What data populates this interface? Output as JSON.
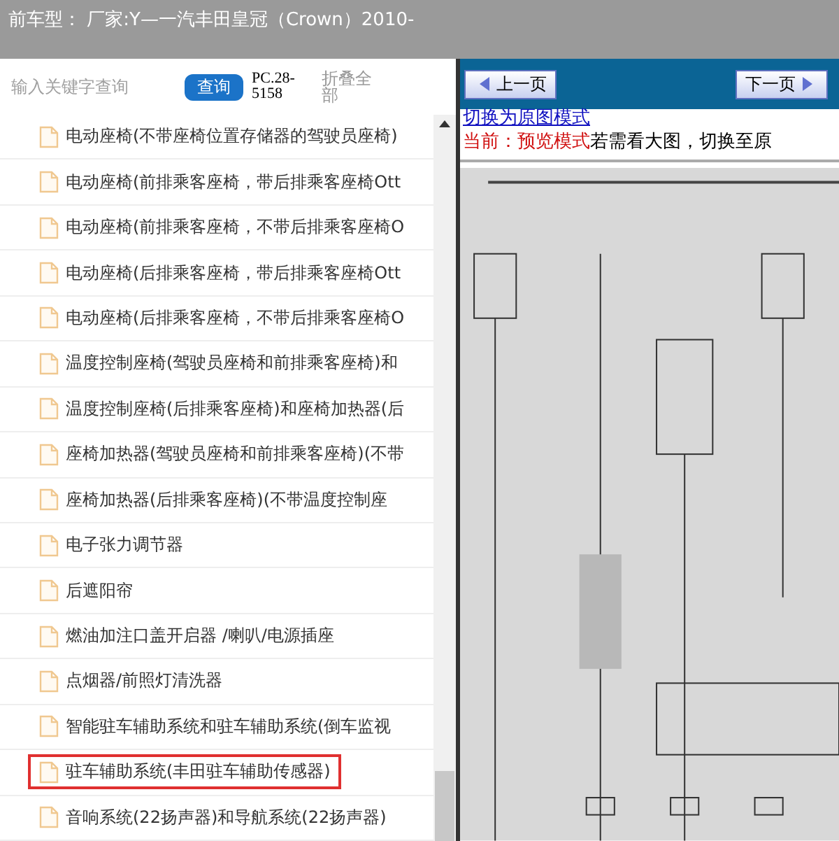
{
  "header": {
    "title": "前车型： 厂家:Y—一汽丰田皇冠（Crown）2010-"
  },
  "toolbar": {
    "search": {
      "placeholder": "输入关键字查询"
    },
    "search_button": "查询",
    "code": "PC.28-5158",
    "collapse_all": "折叠全部"
  },
  "tree": {
    "items": [
      {
        "label": "电动座椅(不带座椅位置存储器的驾驶员座椅)",
        "selected": false
      },
      {
        "label": "电动座椅(前排乘客座椅，带后排乘客座椅Ott",
        "selected": false
      },
      {
        "label": "电动座椅(前排乘客座椅，不带后排乘客座椅O",
        "selected": false
      },
      {
        "label": "电动座椅(后排乘客座椅，带后排乘客座椅Ott",
        "selected": false
      },
      {
        "label": "电动座椅(后排乘客座椅，不带后排乘客座椅O",
        "selected": false
      },
      {
        "label": "温度控制座椅(驾驶员座椅和前排乘客座椅)和",
        "selected": false
      },
      {
        "label": "温度控制座椅(后排乘客座椅)和座椅加热器(后",
        "selected": false
      },
      {
        "label": "座椅加热器(驾驶员座椅和前排乘客座椅)(不带",
        "selected": false
      },
      {
        "label": "座椅加热器(后排乘客座椅)(不带温度控制座",
        "selected": false
      },
      {
        "label": "电子张力调节器",
        "selected": false
      },
      {
        "label": "后遮阳帘",
        "selected": false
      },
      {
        "label": "燃油加注口盖开启器 /喇叭/电源插座",
        "selected": false
      },
      {
        "label": "点烟器/前照灯清洗器",
        "selected": false
      },
      {
        "label": "智能驻车辅助系统和驻车辅助系统(倒车监视",
        "selected": false
      },
      {
        "label": "驻车辅助系统(丰田驻车辅助传感器)",
        "selected": true
      },
      {
        "label": "音响系统(22扬声器)和导航系统(22扬声器)",
        "selected": false
      }
    ]
  },
  "viewer": {
    "prev_button": "上一页",
    "next_button": "下一页",
    "mode_link": "切换为原图模式",
    "mode_label": "当前：预览模式",
    "mode_hint": "若需看大图，切换至原"
  }
}
